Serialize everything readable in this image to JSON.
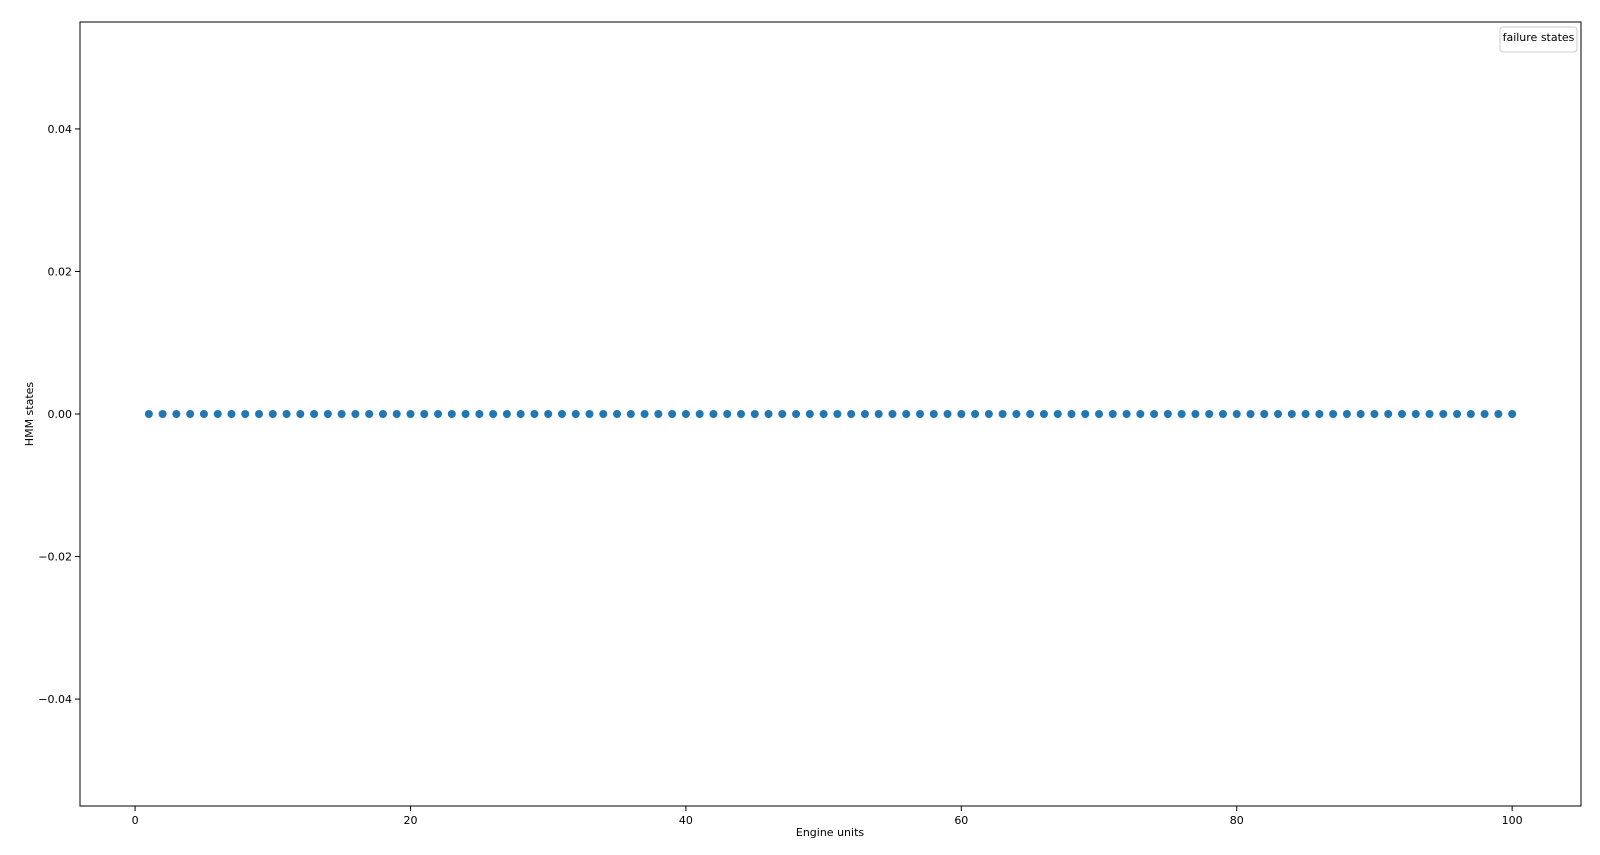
{
  "chart_data": {
    "type": "scatter",
    "title": "",
    "xlabel": "Engine units",
    "ylabel": "HMM states",
    "xlim": [
      -4,
      105
    ],
    "ylim": [
      -0.055,
      0.055
    ],
    "xticks": [
      0,
      20,
      40,
      60,
      80,
      100
    ],
    "xtick_labels": [
      "0",
      "20",
      "40",
      "60",
      "80",
      "100"
    ],
    "yticks": [
      -0.04,
      -0.02,
      0.0,
      0.02,
      0.04
    ],
    "ytick_labels": [
      "−0.04",
      "−0.02",
      "0.00",
      "0.02",
      "0.04"
    ],
    "grid": false,
    "legend": {
      "title": "failure states",
      "placement": "top-right"
    },
    "marker_color": "#1f77b4",
    "series": [
      {
        "x": [
          1,
          2,
          3,
          4,
          5,
          6,
          7,
          8,
          9,
          10,
          11,
          12,
          13,
          14,
          15,
          16,
          17,
          18,
          19,
          20,
          21,
          22,
          23,
          24,
          25,
          26,
          27,
          28,
          29,
          30,
          31,
          32,
          33,
          34,
          35,
          36,
          37,
          38,
          39,
          40,
          41,
          42,
          43,
          44,
          45,
          46,
          47,
          48,
          49,
          50,
          51,
          52,
          53,
          54,
          55,
          56,
          57,
          58,
          59,
          60,
          61,
          62,
          63,
          64,
          65,
          66,
          67,
          68,
          69,
          70,
          71,
          72,
          73,
          74,
          75,
          76,
          77,
          78,
          79,
          80,
          81,
          82,
          83,
          84,
          85,
          86,
          87,
          88,
          89,
          90,
          91,
          92,
          93,
          94,
          95,
          96,
          97,
          98,
          99,
          100
        ],
        "y": [
          0,
          0,
          0,
          0,
          0,
          0,
          0,
          0,
          0,
          0,
          0,
          0,
          0,
          0,
          0,
          0,
          0,
          0,
          0,
          0,
          0,
          0,
          0,
          0,
          0,
          0,
          0,
          0,
          0,
          0,
          0,
          0,
          0,
          0,
          0,
          0,
          0,
          0,
          0,
          0,
          0,
          0,
          0,
          0,
          0,
          0,
          0,
          0,
          0,
          0,
          0,
          0,
          0,
          0,
          0,
          0,
          0,
          0,
          0,
          0,
          0,
          0,
          0,
          0,
          0,
          0,
          0,
          0,
          0,
          0,
          0,
          0,
          0,
          0,
          0,
          0,
          0,
          0,
          0,
          0,
          0,
          0,
          0,
          0,
          0,
          0,
          0,
          0,
          0,
          0,
          0,
          0,
          0,
          0,
          0,
          0,
          0,
          0,
          0,
          0
        ]
      }
    ]
  }
}
